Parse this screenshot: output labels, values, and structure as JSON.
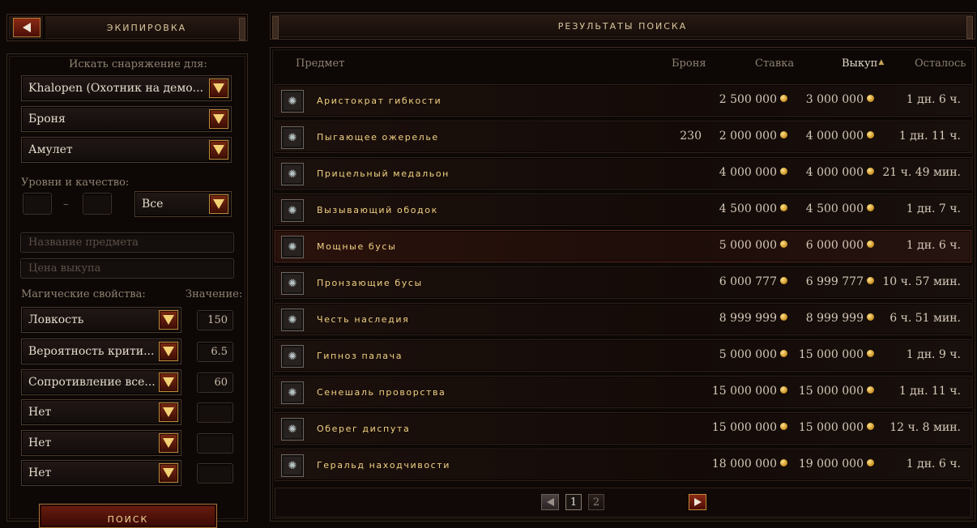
{
  "left": {
    "title": "ЭКИПИРОВКА",
    "search_for_label": "Искать снаряжение для:",
    "character": "Khalopen (Охотник на демо...",
    "type": "Броня",
    "subtype": "Амулет",
    "levels_label": "Уровни и качество:",
    "level_min": "",
    "level_max": "",
    "range_sep": "–",
    "quality": "Все",
    "item_name_placeholder": "Название предмета",
    "buyout_placeholder": "Цена выкупа",
    "magic_label": "Магические свойства:",
    "value_label": "Значение:",
    "properties": [
      {
        "name": "Ловкость",
        "value": "150"
      },
      {
        "name": "Вероятность крити...",
        "value": "6.5"
      },
      {
        "name": "Сопротивление все...",
        "value": "60"
      },
      {
        "name": "Нет",
        "value": ""
      },
      {
        "name": "Нет",
        "value": ""
      },
      {
        "name": "Нет",
        "value": ""
      }
    ],
    "search_button": "ПОИСК"
  },
  "results": {
    "title": "РЕЗУЛЬТАТЫ ПОИСКА",
    "columns": {
      "item": "Предмет",
      "armor": "Броня",
      "bid": "Ставка",
      "buyout": "Выкуп",
      "remaining": "Осталось"
    },
    "rows": [
      {
        "name": "Аристократ гибкости",
        "armor": "",
        "bid": "2 500 000",
        "buyout": "3 000 000",
        "remaining": "1 дн. 6 ч."
      },
      {
        "name": "Пыгающее ожерелье",
        "armor": "230",
        "bid": "2 000 000",
        "buyout": "4 000 000",
        "remaining": "1 дн. 11 ч."
      },
      {
        "name": "Прицельный медальон",
        "armor": "",
        "bid": "4 000 000",
        "buyout": "4 000 000",
        "remaining": "21 ч. 49 мин."
      },
      {
        "name": "Вызывающий ободок",
        "armor": "",
        "bid": "4 500 000",
        "buyout": "4 500 000",
        "remaining": "1 дн. 7 ч."
      },
      {
        "name": "Мощные бусы",
        "armor": "",
        "bid": "5 000 000",
        "buyout": "6 000 000",
        "remaining": "1 дн. 6 ч."
      },
      {
        "name": "Пронзающие бусы",
        "armor": "",
        "bid": "6 000 777",
        "buyout": "6 999 777",
        "remaining": "10 ч. 57 мин."
      },
      {
        "name": "Честь наследия",
        "armor": "",
        "bid": "8 999 999",
        "buyout": "8 999 999",
        "remaining": "6 ч. 51 мин."
      },
      {
        "name": "Гипноз палача",
        "armor": "",
        "bid": "5 000 000",
        "buyout": "15 000 000",
        "remaining": "1 дн. 9 ч."
      },
      {
        "name": "Сенешаль проворства",
        "armor": "",
        "bid": "15 000 000",
        "buyout": "15 000 000",
        "remaining": "1 дн. 11 ч."
      },
      {
        "name": "Оберег диспута",
        "armor": "",
        "bid": "15 000 000",
        "buyout": "15 000 000",
        "remaining": "12 ч. 8 мин."
      },
      {
        "name": "Геральд находчивости",
        "armor": "",
        "bid": "18 000 000",
        "buyout": "19 000 000",
        "remaining": "1 дн. 6 ч."
      }
    ],
    "selected_row": 4,
    "pages": [
      "1",
      "2"
    ],
    "current_page": "1"
  }
}
